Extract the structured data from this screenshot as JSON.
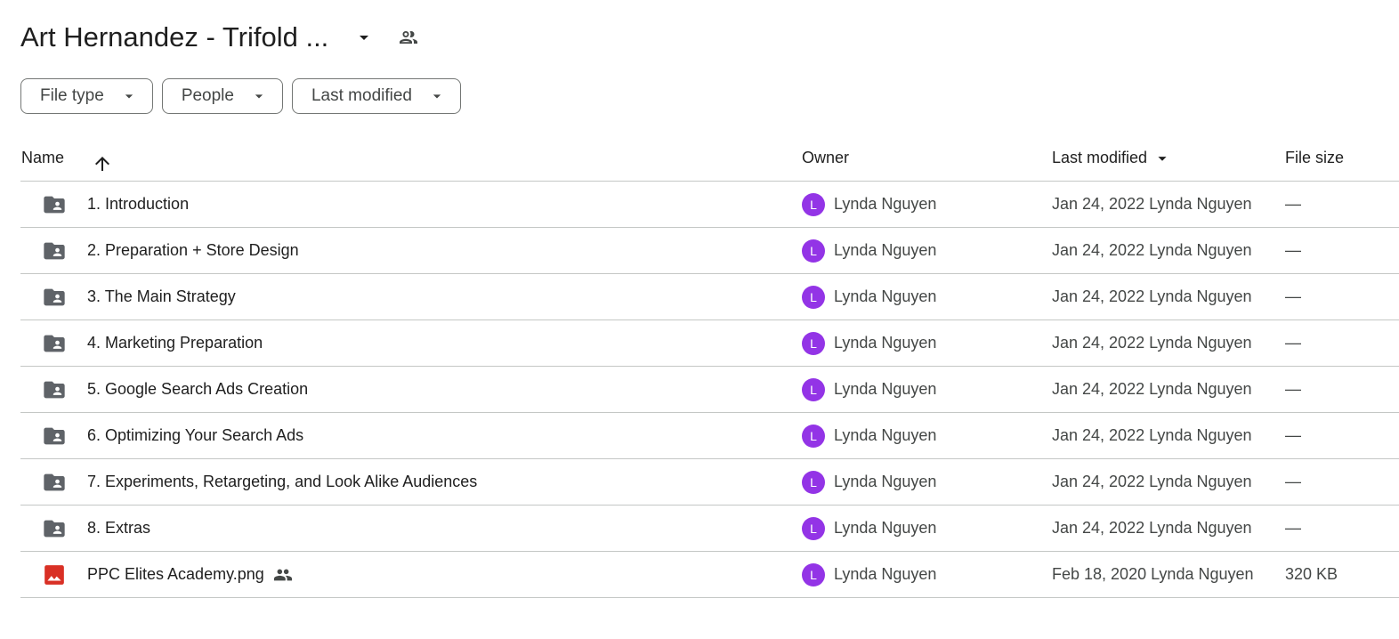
{
  "header": {
    "title": "Art Hernandez - Trifold ...",
    "caret_icon": "arrow-drop-down-icon",
    "share_icon": "people-icon"
  },
  "filters": [
    {
      "label": "File type",
      "icon": "arrow-drop-down-icon"
    },
    {
      "label": "People",
      "icon": "arrow-drop-down-icon"
    },
    {
      "label": "Last modified",
      "icon": "arrow-drop-down-icon"
    }
  ],
  "table": {
    "columns": {
      "name": "Name",
      "owner": "Owner",
      "last_modified": "Last modified",
      "file_size": "File size"
    },
    "sort_icon": "arrow-up-icon",
    "modified_sort_icon": "arrow-drop-down-icon",
    "rows": [
      {
        "type": "shared-folder",
        "name": "1. Introduction",
        "owner_initial": "L",
        "owner": "Lynda Nguyen",
        "modified": "Jan 24, 2022 Lynda Nguyen",
        "size": "—",
        "shared": false
      },
      {
        "type": "shared-folder",
        "name": "2. Preparation + Store Design",
        "owner_initial": "L",
        "owner": "Lynda Nguyen",
        "modified": "Jan 24, 2022 Lynda Nguyen",
        "size": "—",
        "shared": false
      },
      {
        "type": "shared-folder",
        "name": "3. The Main Strategy",
        "owner_initial": "L",
        "owner": "Lynda Nguyen",
        "modified": "Jan 24, 2022 Lynda Nguyen",
        "size": "—",
        "shared": false
      },
      {
        "type": "shared-folder",
        "name": "4. Marketing Preparation",
        "owner_initial": "L",
        "owner": "Lynda Nguyen",
        "modified": "Jan 24, 2022 Lynda Nguyen",
        "size": "—",
        "shared": false
      },
      {
        "type": "shared-folder",
        "name": "5. Google Search Ads Creation",
        "owner_initial": "L",
        "owner": "Lynda Nguyen",
        "modified": "Jan 24, 2022 Lynda Nguyen",
        "size": "—",
        "shared": false
      },
      {
        "type": "shared-folder",
        "name": "6. Optimizing Your Search Ads",
        "owner_initial": "L",
        "owner": "Lynda Nguyen",
        "modified": "Jan 24, 2022 Lynda Nguyen",
        "size": "—",
        "shared": false
      },
      {
        "type": "shared-folder",
        "name": "7. Experiments, Retargeting, and Look Alike Audiences",
        "owner_initial": "L",
        "owner": "Lynda Nguyen",
        "modified": "Jan 24, 2022 Lynda Nguyen",
        "size": "—",
        "shared": false
      },
      {
        "type": "shared-folder",
        "name": "8. Extras",
        "owner_initial": "L",
        "owner": "Lynda Nguyen",
        "modified": "Jan 24, 2022 Lynda Nguyen",
        "size": "—",
        "shared": false
      },
      {
        "type": "image",
        "name": "PPC Elites Academy.png",
        "owner_initial": "L",
        "owner": "Lynda Nguyen",
        "modified": "Feb 18, 2020 Lynda Nguyen",
        "size": "320 KB",
        "shared": true
      }
    ]
  },
  "colors": {
    "avatar": "#9334e6",
    "folder_icon": "#5f6368",
    "image_icon": "#d93025",
    "divider": "#c4c7c5"
  }
}
